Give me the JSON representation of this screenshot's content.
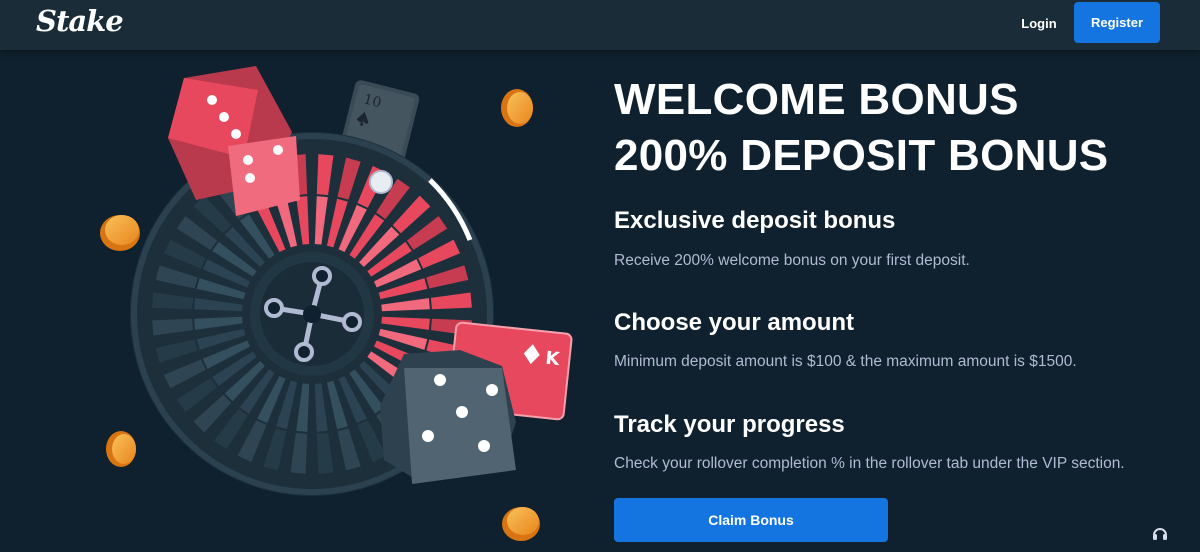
{
  "header": {
    "logo": "Stake",
    "login_label": "Login",
    "register_label": "Register"
  },
  "hero": {
    "headline_line1": "WELCOME BONUS",
    "headline_line2": "200% DEPOSIT BONUS",
    "steps": [
      {
        "title": "Exclusive deposit bonus",
        "description": "Receive 200% welcome bonus on your first deposit."
      },
      {
        "title": "Choose your amount",
        "description": "Minimum deposit amount is $100 & the maximum amount is $1500."
      },
      {
        "title": "Track your progress",
        "description": "Check your rollover completion % in the rollover tab under the VIP section."
      }
    ],
    "cta_label": "Claim Bonus"
  },
  "illustration": {
    "card_back": "10",
    "card_front": "K"
  },
  "icons": {
    "support": "headset-icon"
  },
  "colors": {
    "background": "#0f212e",
    "topbar": "#1a2c38",
    "accent": "#1475e1",
    "muted_text": "#b1bad3",
    "red": "#e7485e",
    "coin": "#f6a331"
  }
}
